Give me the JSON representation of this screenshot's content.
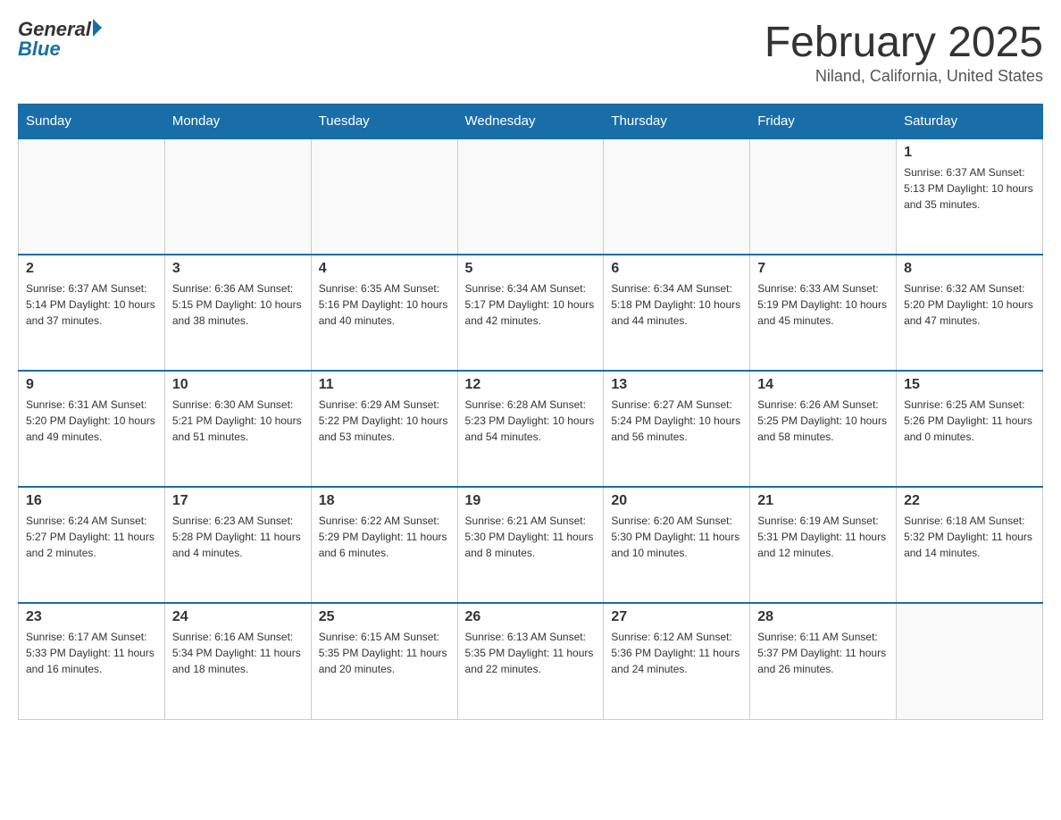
{
  "header": {
    "logo_general": "General",
    "logo_blue": "Blue",
    "title": "February 2025",
    "location": "Niland, California, United States"
  },
  "days_of_week": [
    "Sunday",
    "Monday",
    "Tuesday",
    "Wednesday",
    "Thursday",
    "Friday",
    "Saturday"
  ],
  "weeks": [
    [
      {
        "day": "",
        "info": ""
      },
      {
        "day": "",
        "info": ""
      },
      {
        "day": "",
        "info": ""
      },
      {
        "day": "",
        "info": ""
      },
      {
        "day": "",
        "info": ""
      },
      {
        "day": "",
        "info": ""
      },
      {
        "day": "1",
        "info": "Sunrise: 6:37 AM\nSunset: 5:13 PM\nDaylight: 10 hours and 35 minutes."
      }
    ],
    [
      {
        "day": "2",
        "info": "Sunrise: 6:37 AM\nSunset: 5:14 PM\nDaylight: 10 hours and 37 minutes."
      },
      {
        "day": "3",
        "info": "Sunrise: 6:36 AM\nSunset: 5:15 PM\nDaylight: 10 hours and 38 minutes."
      },
      {
        "day": "4",
        "info": "Sunrise: 6:35 AM\nSunset: 5:16 PM\nDaylight: 10 hours and 40 minutes."
      },
      {
        "day": "5",
        "info": "Sunrise: 6:34 AM\nSunset: 5:17 PM\nDaylight: 10 hours and 42 minutes."
      },
      {
        "day": "6",
        "info": "Sunrise: 6:34 AM\nSunset: 5:18 PM\nDaylight: 10 hours and 44 minutes."
      },
      {
        "day": "7",
        "info": "Sunrise: 6:33 AM\nSunset: 5:19 PM\nDaylight: 10 hours and 45 minutes."
      },
      {
        "day": "8",
        "info": "Sunrise: 6:32 AM\nSunset: 5:20 PM\nDaylight: 10 hours and 47 minutes."
      }
    ],
    [
      {
        "day": "9",
        "info": "Sunrise: 6:31 AM\nSunset: 5:20 PM\nDaylight: 10 hours and 49 minutes."
      },
      {
        "day": "10",
        "info": "Sunrise: 6:30 AM\nSunset: 5:21 PM\nDaylight: 10 hours and 51 minutes."
      },
      {
        "day": "11",
        "info": "Sunrise: 6:29 AM\nSunset: 5:22 PM\nDaylight: 10 hours and 53 minutes."
      },
      {
        "day": "12",
        "info": "Sunrise: 6:28 AM\nSunset: 5:23 PM\nDaylight: 10 hours and 54 minutes."
      },
      {
        "day": "13",
        "info": "Sunrise: 6:27 AM\nSunset: 5:24 PM\nDaylight: 10 hours and 56 minutes."
      },
      {
        "day": "14",
        "info": "Sunrise: 6:26 AM\nSunset: 5:25 PM\nDaylight: 10 hours and 58 minutes."
      },
      {
        "day": "15",
        "info": "Sunrise: 6:25 AM\nSunset: 5:26 PM\nDaylight: 11 hours and 0 minutes."
      }
    ],
    [
      {
        "day": "16",
        "info": "Sunrise: 6:24 AM\nSunset: 5:27 PM\nDaylight: 11 hours and 2 minutes."
      },
      {
        "day": "17",
        "info": "Sunrise: 6:23 AM\nSunset: 5:28 PM\nDaylight: 11 hours and 4 minutes."
      },
      {
        "day": "18",
        "info": "Sunrise: 6:22 AM\nSunset: 5:29 PM\nDaylight: 11 hours and 6 minutes."
      },
      {
        "day": "19",
        "info": "Sunrise: 6:21 AM\nSunset: 5:30 PM\nDaylight: 11 hours and 8 minutes."
      },
      {
        "day": "20",
        "info": "Sunrise: 6:20 AM\nSunset: 5:30 PM\nDaylight: 11 hours and 10 minutes."
      },
      {
        "day": "21",
        "info": "Sunrise: 6:19 AM\nSunset: 5:31 PM\nDaylight: 11 hours and 12 minutes."
      },
      {
        "day": "22",
        "info": "Sunrise: 6:18 AM\nSunset: 5:32 PM\nDaylight: 11 hours and 14 minutes."
      }
    ],
    [
      {
        "day": "23",
        "info": "Sunrise: 6:17 AM\nSunset: 5:33 PM\nDaylight: 11 hours and 16 minutes."
      },
      {
        "day": "24",
        "info": "Sunrise: 6:16 AM\nSunset: 5:34 PM\nDaylight: 11 hours and 18 minutes."
      },
      {
        "day": "25",
        "info": "Sunrise: 6:15 AM\nSunset: 5:35 PM\nDaylight: 11 hours and 20 minutes."
      },
      {
        "day": "26",
        "info": "Sunrise: 6:13 AM\nSunset: 5:35 PM\nDaylight: 11 hours and 22 minutes."
      },
      {
        "day": "27",
        "info": "Sunrise: 6:12 AM\nSunset: 5:36 PM\nDaylight: 11 hours and 24 minutes."
      },
      {
        "day": "28",
        "info": "Sunrise: 6:11 AM\nSunset: 5:37 PM\nDaylight: 11 hours and 26 minutes."
      },
      {
        "day": "",
        "info": ""
      }
    ]
  ]
}
